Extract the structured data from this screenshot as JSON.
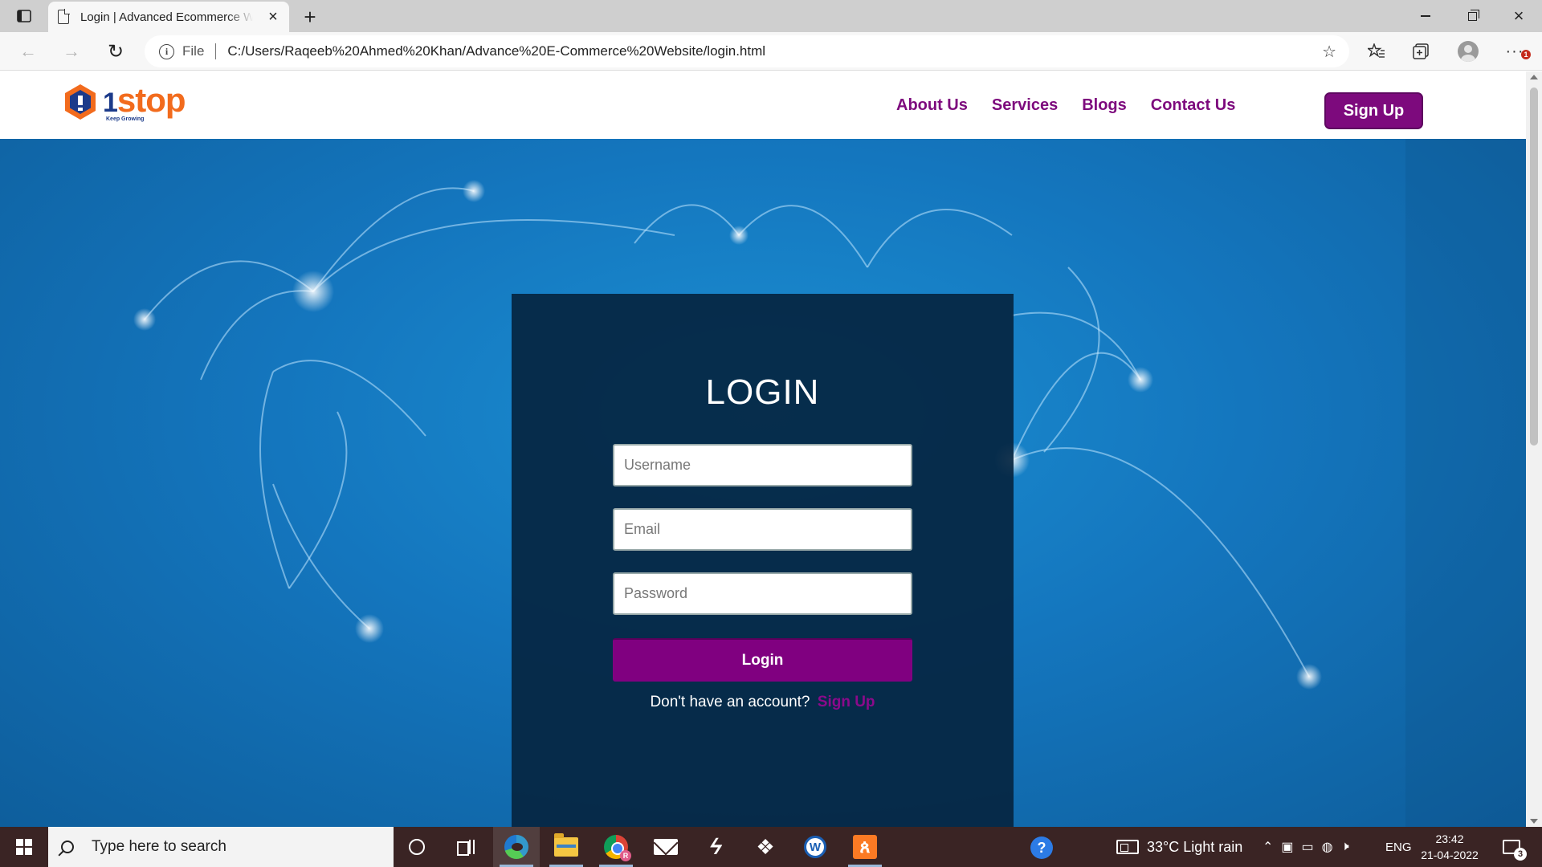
{
  "browser": {
    "tab_title": "Login | Advanced Ecommerce W",
    "address_scheme": "File",
    "url": "C:/Users/Raqeeb%20Ahmed%20Khan/Advance%20E-Commerce%20Website/login.html",
    "notification_badge": "1"
  },
  "site": {
    "logo_number": "1",
    "logo_text": "stop",
    "logo_tagline": "Keep Growing",
    "nav": [
      "About Us",
      "Services",
      "Blogs",
      "Contact Us"
    ],
    "signup_label": "Sign Up",
    "brand_color": "#7d0a7d"
  },
  "login": {
    "title": "LOGIN",
    "username_placeholder": "Username",
    "email_placeholder": "Email",
    "password_placeholder": "Password",
    "button_label": "Login",
    "no_account_text": "Don't have an account?",
    "signup_link": "Sign Up"
  },
  "taskbar": {
    "search_placeholder": "Type here to search",
    "chrome_badge": "R",
    "weather": "33°C  Light rain",
    "language": "ENG",
    "time": "23:42",
    "date": "21-04-2022",
    "notification_count": "3"
  }
}
